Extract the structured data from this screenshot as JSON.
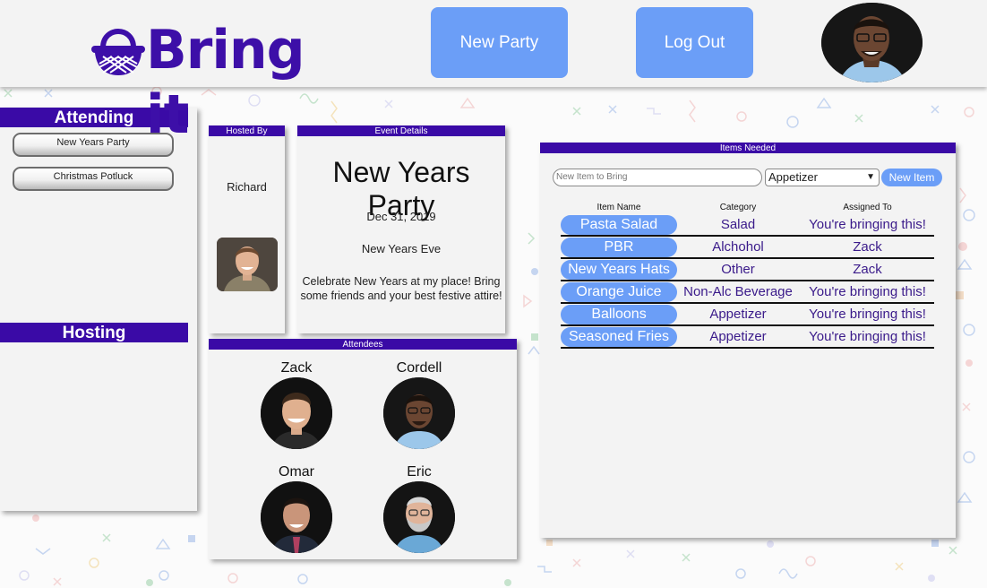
{
  "header": {
    "brand": "Bring it",
    "new_party_label": "New Party",
    "logout_label": "Log Out",
    "avatar_icon": "user-avatar"
  },
  "sidebar": {
    "attending_label": "Attending",
    "attending": [
      "New Years Party",
      "Christmas Potluck"
    ],
    "hosting_label": "Hosting"
  },
  "hosted": {
    "label": "Hosted By",
    "name": "Richard"
  },
  "event": {
    "label": "Event Details",
    "title": "New Years Party",
    "date": "Dec 31, 2019",
    "name": "New Years Eve",
    "description": "Celebrate New Years at my place! Bring some friends and your best festive attire!"
  },
  "attendees": {
    "label": "Attendees",
    "people": [
      "Zack",
      "Cordell",
      "Omar",
      "Eric"
    ]
  },
  "items": {
    "label": "Items Needed",
    "input_placeholder": "New Item to Bring",
    "category_selected": "Appetizer",
    "new_item_label": "New Item",
    "columns": [
      "Item Name",
      "Category",
      "Assigned To"
    ],
    "rows": [
      {
        "name": "Pasta Salad",
        "category": "Salad",
        "assigned": "You're bringing this!"
      },
      {
        "name": "PBR",
        "category": "Alchohol",
        "assigned": "Zack"
      },
      {
        "name": "New Years Hats",
        "category": "Other",
        "assigned": "Zack"
      },
      {
        "name": "Orange Juice",
        "category": "Non-Alc Beverage",
        "assigned": "You're bringing this!"
      },
      {
        "name": "Balloons",
        "category": "Appetizer",
        "assigned": "You're bringing this!"
      },
      {
        "name": "Seasoned Fries",
        "category": "Appetizer",
        "assigned": "You're bringing this!"
      }
    ]
  },
  "colors": {
    "brand_purple": "#3a0aa6",
    "button_blue": "#6b9ef7",
    "panel_gray": "#f3f3f3"
  }
}
